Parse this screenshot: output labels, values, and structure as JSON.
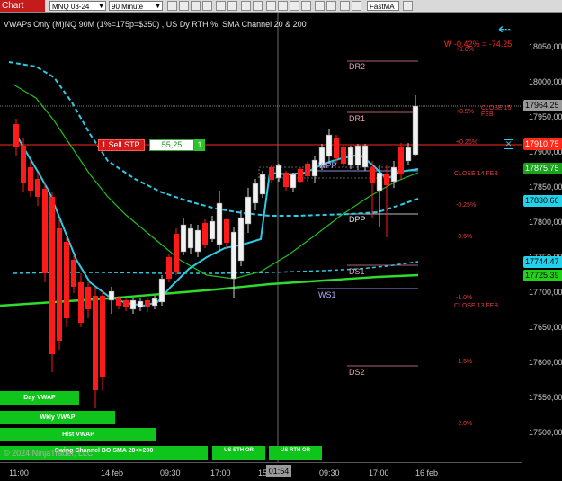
{
  "toolbar": {
    "tab_label": "Chart",
    "instrument": "MNQ 03-24",
    "timeframe": "90 Minute",
    "strategy": "FastMA"
  },
  "chart_header": {
    "title": "VWAPs Only (M)NQ 90M  (1%=175p=$350) , US Dy RTH %, SMA Channel 20 & 200",
    "pnl": "W -0.42% = -74.25",
    "copyright": "© 2024 NinjaTrader, LLC",
    "back_icon": "arrow-left-icon"
  },
  "price_axis": {
    "ticks": [
      "18050,00",
      "18000,00",
      "17950,00",
      "17900,00",
      "17850,00",
      "17800,00",
      "17750,00",
      "17700,00",
      "17650,00",
      "17600,00",
      "17550,00",
      "17500,00"
    ],
    "markers": [
      {
        "label": "17964,25",
        "bg": "#9a9a9a",
        "fg": "#000000"
      },
      {
        "label": "17910,75",
        "bg": "#ff2a1a",
        "fg": "#ffffff"
      },
      {
        "label": "17875,75",
        "bg": "#1aa21a",
        "fg": "#ffffff"
      },
      {
        "label": "17830,66",
        "bg": "#22d2ea",
        "fg": "#000000"
      },
      {
        "label": "17744,47",
        "bg": "#22d2ea",
        "fg": "#000000"
      },
      {
        "label": "17725,39",
        "bg": "#22d21a",
        "fg": "#000000"
      }
    ]
  },
  "time_axis": {
    "labels": [
      "11:00",
      "14 feb",
      "09:30",
      "17:00",
      "15",
      "09:30",
      "17:00",
      "16 feb"
    ],
    "crosshair_time": "01:54"
  },
  "order": {
    "label": "1  Sell STP",
    "price": "55,25",
    "qty": "1"
  },
  "pivot_labels": [
    "DR2",
    "DR1",
    "WPP",
    "DPP",
    "DS1",
    "WS1",
    "DS2"
  ],
  "pct_labels": [
    "+1.0%",
    "+0.5%",
    "+0.25%",
    "-0.25%",
    "-0.5%",
    "-1.0%",
    "-1.5%",
    "-2.0%"
  ],
  "close_labels": [
    "CLOSE 15 FEB",
    "CLOSE 14 FEB",
    "CLOSE 13 FEB"
  ],
  "vwap_buttons": [
    "Day VWAP",
    "Wkly VWAP",
    "Hist VWAP",
    "Swing Channel BO  SMA 20<>200",
    "US ETH OR",
    "US RTH OR"
  ],
  "colors": {
    "bull": "#f2f2f2",
    "bear": "#ff1a1a",
    "sma_fast": "#20c020",
    "sma_slow": "#2ddc2d",
    "vwap": "#2ecbe6"
  }
}
